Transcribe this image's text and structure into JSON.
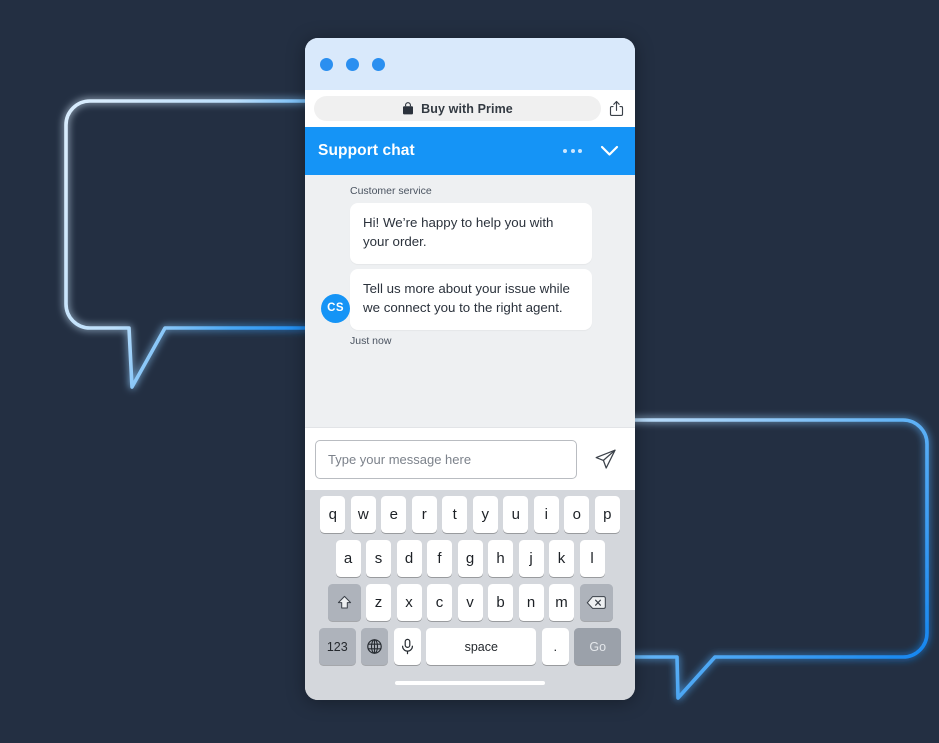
{
  "background": {
    "color": "#232f42",
    "decor_bubbles": [
      {
        "name": "speech-bubble-left",
        "stroke_from": "#cfe6fb",
        "stroke_to": "#1f8ef1"
      },
      {
        "name": "speech-bubble-right",
        "stroke_from": "#9ed2fb",
        "stroke_to": "#1f8ef1"
      }
    ]
  },
  "phone": {
    "browser": {
      "traffic_dots": 3,
      "dot_color": "#2a8ff0",
      "address_bar": {
        "lock_icon": "shopping-bag-icon",
        "label": "Buy with Prime",
        "share_icon": "share-icon"
      }
    },
    "chat_header": {
      "title": "Support chat",
      "accent": "#1594f6",
      "more_icon": "more-dots-icon",
      "collapse_icon": "chevron-down-icon"
    },
    "conversation": {
      "sender": "Customer service",
      "avatar_initials": "CS",
      "avatar_color": "#1594f6",
      "messages": [
        "Hi! We’re happy to help you with your order.",
        "Tell us more about your issue while we connect you to the right agent."
      ],
      "timestamp": "Just now"
    },
    "composer": {
      "placeholder": "Type your message here",
      "value": "",
      "send_icon": "send-paper-plane-icon"
    },
    "keyboard": {
      "row1": [
        "q",
        "w",
        "e",
        "r",
        "t",
        "y",
        "u",
        "i",
        "o",
        "p"
      ],
      "row2": [
        "a",
        "s",
        "d",
        "f",
        "g",
        "h",
        "j",
        "k",
        "l"
      ],
      "row3": [
        "z",
        "x",
        "c",
        "v",
        "b",
        "n",
        "m"
      ],
      "shift_icon": "shift-up-arrow-icon",
      "backspace_icon": "backspace-delete-icon",
      "numbers_key": "123",
      "globe_icon": "globe-language-icon",
      "mic_icon": "microphone-icon",
      "space_key": "space",
      "period_key": ".",
      "go_key": "Go"
    },
    "home_indicator": true
  }
}
